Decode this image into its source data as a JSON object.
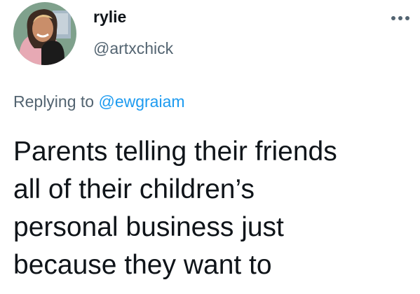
{
  "user": {
    "display_name": "rylie",
    "handle": "@artxchick",
    "avatar": "profile-photo"
  },
  "reply": {
    "prefix": "Replying to",
    "mention": "@ewgraiam"
  },
  "tweet": {
    "lines": [
      "Parents telling their friends",
      "all of their children’s",
      "personal business just",
      "because they want to"
    ]
  },
  "icons": {
    "more": "more-horizontal-icon"
  },
  "colors": {
    "text": "#0f1419",
    "secondary": "#536471",
    "link": "#1d9bf0",
    "background": "#ffffff"
  }
}
